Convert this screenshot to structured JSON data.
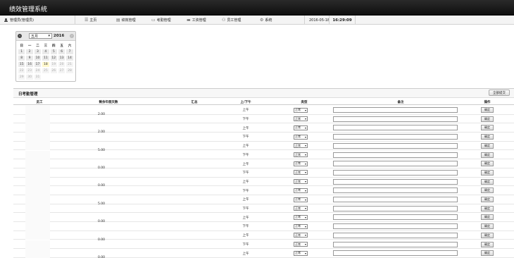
{
  "app": {
    "title": "绩效管理系统"
  },
  "user": {
    "label": "管理员(管理员)"
  },
  "nav": [
    {
      "icon": "list-icon",
      "label": "主页"
    },
    {
      "icon": "clipboard-icon",
      "label": "绩效管理"
    },
    {
      "icon": "briefcase-icon",
      "label": "考勤管理"
    },
    {
      "icon": "card-icon",
      "label": "工资管理"
    },
    {
      "icon": "users-icon",
      "label": "员工管理"
    },
    {
      "icon": "gear-icon",
      "label": "系统"
    }
  ],
  "datetime": {
    "date": "2016-05-18",
    "time": "16:29:09"
  },
  "calendar": {
    "month": "五月",
    "year": "2016",
    "prev": "‹",
    "next": "›",
    "weekdays": [
      "日",
      "一",
      "二",
      "三",
      "四",
      "五",
      "六"
    ],
    "weeks": [
      [
        {
          "d": "1",
          "t": ""
        },
        {
          "d": "2",
          "t": ""
        },
        {
          "d": "3",
          "t": ""
        },
        {
          "d": "4",
          "t": ""
        },
        {
          "d": "5",
          "t": ""
        },
        {
          "d": "6",
          "t": ""
        },
        {
          "d": "7",
          "t": ""
        }
      ],
      [
        {
          "d": "8",
          "t": ""
        },
        {
          "d": "9",
          "t": ""
        },
        {
          "d": "10",
          "t": ""
        },
        {
          "d": "11",
          "t": ""
        },
        {
          "d": "12",
          "t": ""
        },
        {
          "d": "13",
          "t": ""
        },
        {
          "d": "14",
          "t": ""
        }
      ],
      [
        {
          "d": "15",
          "t": ""
        },
        {
          "d": "16",
          "t": ""
        },
        {
          "d": "17",
          "t": ""
        },
        {
          "d": "18",
          "t": "today"
        },
        {
          "d": "19",
          "t": "other"
        },
        {
          "d": "20",
          "t": "other"
        },
        {
          "d": "21",
          "t": "other"
        }
      ],
      [
        {
          "d": "22",
          "t": "other"
        },
        {
          "d": "23",
          "t": "other"
        },
        {
          "d": "24",
          "t": "other"
        },
        {
          "d": "25",
          "t": "other"
        },
        {
          "d": "26",
          "t": "other"
        },
        {
          "d": "27",
          "t": "other"
        },
        {
          "d": "28",
          "t": "other"
        }
      ],
      [
        {
          "d": "29",
          "t": "other"
        },
        {
          "d": "30",
          "t": "other"
        },
        {
          "d": "31",
          "t": "other"
        }
      ]
    ]
  },
  "panel": {
    "title": "日考勤管理",
    "submit_all": "全部提交",
    "columns": [
      "员工",
      "剩余年假天数",
      "汇总",
      "上/下午",
      "类型",
      "备注",
      "操作"
    ],
    "type_value": "正常",
    "confirm_label": "确定",
    "half_am": "上午",
    "half_pm": "下午",
    "employees": [
      {
        "days": "2.00"
      },
      {
        "days": "2.00"
      },
      {
        "days": "5.00"
      },
      {
        "days": "0.00"
      },
      {
        "days": "0.00"
      },
      {
        "days": "5.00"
      },
      {
        "days": "0.00"
      },
      {
        "days": "0.00"
      },
      {
        "days": "0.00"
      }
    ]
  }
}
